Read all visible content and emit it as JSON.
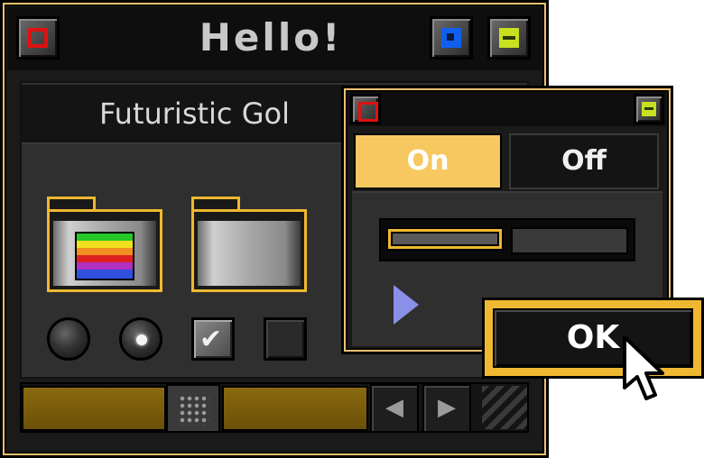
{
  "main_window": {
    "title": "Hello!",
    "panel_title": "Futuristic Gol",
    "close_icon": "close-icon",
    "restore_icon": "restore-icon",
    "menu_icon": "menu-icon"
  },
  "dialog": {
    "toggle_on_label": "On",
    "toggle_off_label": "Off",
    "toggle_selected": "On",
    "slider_value": 0.5,
    "ok_label": "OK"
  },
  "colors": {
    "accent_gold": "#f0b830",
    "toggle_on": "#f8c860",
    "close_red": "#e01010",
    "restore_blue": "#1060f0",
    "menu_green": "#c8e020"
  }
}
